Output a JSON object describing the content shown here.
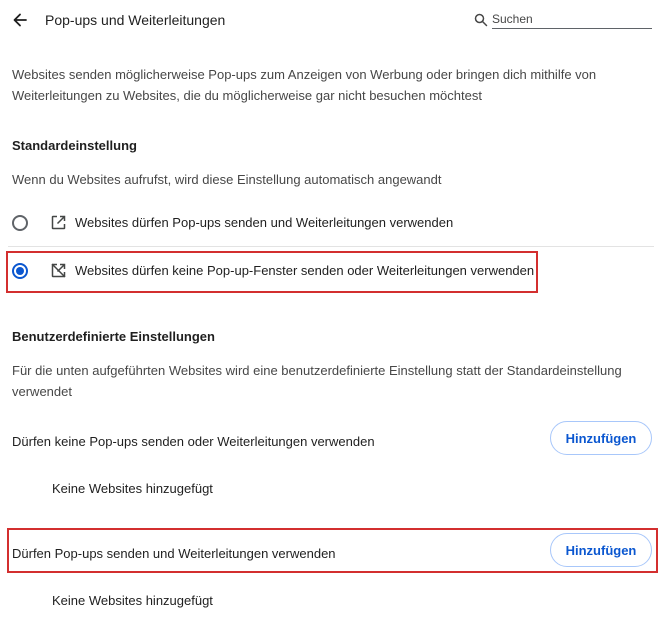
{
  "header": {
    "title": "Pop-ups und Weiterleitungen",
    "search_placeholder": "Suchen",
    "back_icon": "arrow-back-icon",
    "search_icon": "search-icon"
  },
  "description": "Websites senden möglicherweise Pop-ups zum Anzeigen von Werbung oder bringen dich mithilfe von Weiterleitungen zu Websites, die du möglicherweise gar nicht besuchen möchtest",
  "default_section": {
    "heading": "Standardeinstellung",
    "subtext": "Wenn du Websites aufrufst, wird diese Einstellung automatisch angewandt",
    "options": [
      {
        "label": "Websites dürfen Pop-ups senden und Weiterleitungen verwenden",
        "icon": "open-in-new-icon",
        "selected": false
      },
      {
        "label": "Websites dürfen keine Pop-up-Fenster senden oder Weiterleitungen verwenden",
        "icon": "popup-blocked-icon",
        "selected": true
      }
    ]
  },
  "custom_section": {
    "heading": "Benutzerdefinierte Einstellungen",
    "subtext": "Für die unten aufgeführten Websites wird eine benutzerdefinierte Einstellung statt der Standardeinstellung verwendet",
    "blocked": {
      "label": "Dürfen keine Pop-ups senden oder Weiterleitungen verwenden",
      "button": "Hinzufügen",
      "empty": "Keine Websites hinzugefügt"
    },
    "allowed": {
      "label": "Dürfen Pop-ups senden und Weiterleitungen verwenden",
      "button": "Hinzufügen",
      "empty": "Keine Websites hinzugefügt"
    }
  },
  "colors": {
    "accent": "#0b57d0",
    "highlight": "#d32f2f"
  }
}
